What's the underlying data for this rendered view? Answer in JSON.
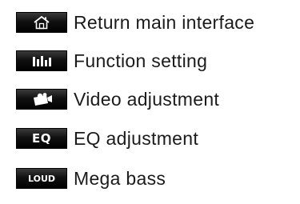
{
  "menu": {
    "items": [
      {
        "icon": "home-icon",
        "label": "Return main interface"
      },
      {
        "icon": "equalizer-bars-icon",
        "label": "Function setting"
      },
      {
        "icon": "video-camera-icon",
        "label": "Video adjustment"
      },
      {
        "icon": "eq-icon",
        "icon_text": "EQ",
        "label": "EQ adjustment"
      },
      {
        "icon": "loud-icon",
        "icon_text": "LOUD",
        "label": "Mega bass"
      }
    ]
  }
}
